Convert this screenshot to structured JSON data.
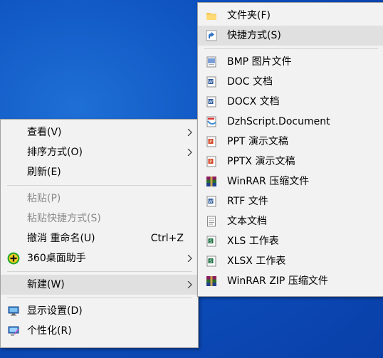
{
  "main_menu": {
    "view": "查看(V)",
    "sort": "排序方式(O)",
    "refresh": "刷新(E)",
    "paste": "粘贴(P)",
    "paste_shortcut": "粘贴快捷方式(S)",
    "undo": "撤消 重命名(U)",
    "undo_shortcut": "Ctrl+Z",
    "assistant": "360桌面助手",
    "new": "新建(W)",
    "display": "显示设置(D)",
    "personalize": "个性化(R)"
  },
  "new_submenu": {
    "items": [
      {
        "label": "文件夹(F)",
        "icon": "folder-icon"
      },
      {
        "label": "快捷方式(S)",
        "icon": "shortcut-icon"
      },
      {
        "label": "BMP 图片文件",
        "icon": "bmp-file-icon"
      },
      {
        "label": "DOC 文档",
        "icon": "word-doc-icon"
      },
      {
        "label": "DOCX 文档",
        "icon": "word-docx-icon"
      },
      {
        "label": "DzhScript.Document",
        "icon": "script-doc-icon"
      },
      {
        "label": "PPT 演示文稿",
        "icon": "ppt-icon"
      },
      {
        "label": "PPTX 演示文稿",
        "icon": "pptx-icon"
      },
      {
        "label": "WinRAR 压缩文件",
        "icon": "winrar-icon"
      },
      {
        "label": "RTF 文件",
        "icon": "rtf-icon"
      },
      {
        "label": "文本文档",
        "icon": "text-doc-icon"
      },
      {
        "label": "XLS 工作表",
        "icon": "xls-icon"
      },
      {
        "label": "XLSX 工作表",
        "icon": "xlsx-icon"
      },
      {
        "label": "WinRAR ZIP 压缩文件",
        "icon": "winrar-zip-icon"
      }
    ]
  },
  "colors": {
    "menu_bg": "#f2f2f2",
    "hover_bg": "#e0e0e0",
    "disabled_text": "#8a8a8a",
    "desktop_blue": "#0c4fbd"
  }
}
